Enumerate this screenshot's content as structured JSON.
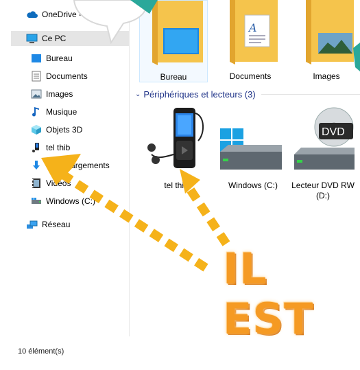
{
  "sidebar": {
    "items": [
      {
        "label": "OneDrive - ",
        "icon": "cloud-icon"
      },
      {
        "label": "Ce PC",
        "icon": "computer-icon",
        "selected": true
      },
      {
        "label": "Bureau",
        "icon": "desktop-icon"
      },
      {
        "label": "Documents",
        "icon": "documents-icon"
      },
      {
        "label": "Images",
        "icon": "images-icon"
      },
      {
        "label": "Musique",
        "icon": "music-icon"
      },
      {
        "label": "Objets 3D",
        "icon": "cube-icon"
      },
      {
        "label": "tel thib",
        "icon": "phone-icon"
      },
      {
        "label": "Téléchargements",
        "icon": "download-icon"
      },
      {
        "label": "Vidéos",
        "icon": "video-icon"
      },
      {
        "label": "Windows (C:)",
        "icon": "drive-icon"
      },
      {
        "label": "Réseau",
        "icon": "network-icon"
      }
    ]
  },
  "folders": [
    {
      "label": "Bureau",
      "icon": "desktop-folder-icon",
      "selected": true
    },
    {
      "label": "Documents",
      "icon": "documents-folder-icon"
    },
    {
      "label": "Images",
      "icon": "images-folder-icon"
    }
  ],
  "devices_section": {
    "title": "Périphériques et lecteurs (3)"
  },
  "devices": [
    {
      "label": "tel thib",
      "icon": "media-player-icon"
    },
    {
      "label": "Windows (C:)",
      "icon": "windows-drive-icon"
    },
    {
      "label": "Lecteur DVD RW (D:)",
      "icon": "dvd-drive-icon"
    }
  ],
  "status_bar": {
    "item_count": "10 élément(s)"
  },
  "annotation": {
    "text": "IL EST",
    "color": "#f5a21b"
  }
}
